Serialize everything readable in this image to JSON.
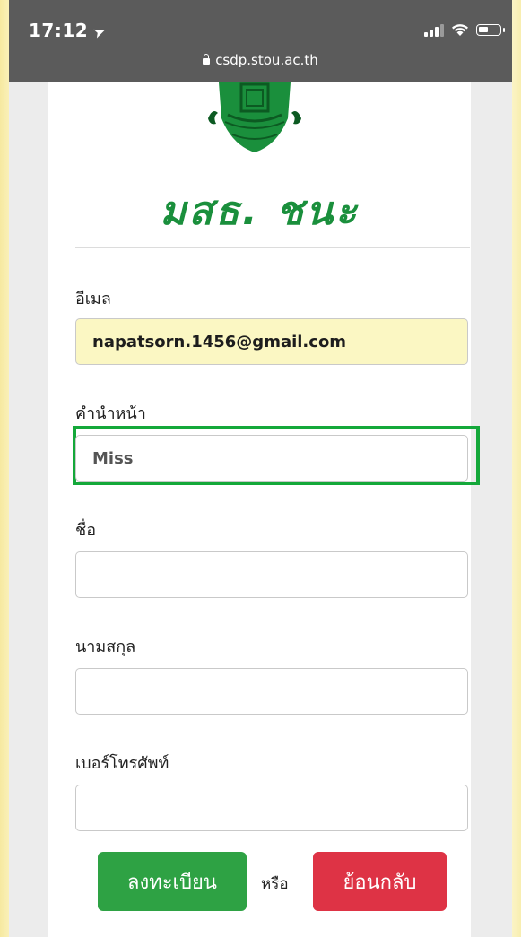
{
  "status_bar": {
    "time": "17:12",
    "location_icon": "location-arrow-icon",
    "signal_icon": "cellular-signal-icon",
    "wifi_icon": "wifi-icon",
    "battery_icon": "battery-icon"
  },
  "browser": {
    "url": "csdp.stou.ac.th",
    "lock_icon": "lock-icon"
  },
  "header": {
    "logo_icon": "university-emblem-icon",
    "brand": "มสธ. ชนะ"
  },
  "form": {
    "email_label": "อีเมล",
    "email_value": "napatsorn.1456@gmail.com",
    "title_label": "คำนำหน้า",
    "title_value": "Miss",
    "firstname_label": "ชื่อ",
    "firstname_value": "",
    "lastname_label": "นามสกุล",
    "lastname_value": "",
    "phone_label": "เบอร์โทรศัพท์",
    "phone_value": ""
  },
  "actions": {
    "register_label": "ลงทะเบียน",
    "or_label": "หรือ",
    "back_label": "ย้อนกลับ"
  },
  "colors": {
    "brand_green": "#1a8f3c",
    "register_button": "#2ea244",
    "back_button": "#de3345",
    "highlight_border": "#14a83a",
    "autofill_background": "#fbf7c3",
    "status_bar": "#5b5b5b"
  }
}
